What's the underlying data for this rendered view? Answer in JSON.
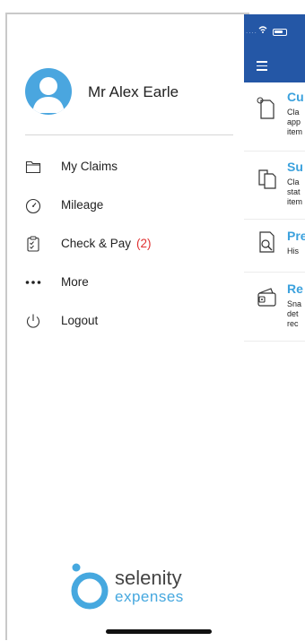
{
  "drawer": {
    "user_name": "Mr Alex Earle",
    "menu": [
      {
        "label": "My Claims",
        "icon": "folder-icon",
        "badge": ""
      },
      {
        "label": "Mileage",
        "icon": "speedometer-icon",
        "badge": ""
      },
      {
        "label": "Check & Pay",
        "icon": "clipboard-check-icon",
        "badge": "(2)"
      },
      {
        "label": "More",
        "icon": "more-dots-icon",
        "badge": ""
      },
      {
        "label": "Logout",
        "icon": "power-icon",
        "badge": ""
      }
    ],
    "logo": {
      "line1": "selenity",
      "line2": "expenses"
    }
  },
  "main": {
    "status_bar": {
      "dots": "...."
    },
    "items": [
      {
        "title": "Cu",
        "desc": "Cla\napp\nitem",
        "icon": "document-icon"
      },
      {
        "title": "Su",
        "desc": "Cla\nstat\nitem",
        "icon": "documents-icon"
      },
      {
        "title": "Pre",
        "desc": "His",
        "icon": "search-document-icon"
      },
      {
        "title": "Re",
        "desc": "Sna\ndet\nrec",
        "icon": "wallet-icon"
      }
    ]
  },
  "colors": {
    "header_blue": "#2457a6",
    "accent": "#46a8df",
    "badge_red": "#e03030"
  }
}
